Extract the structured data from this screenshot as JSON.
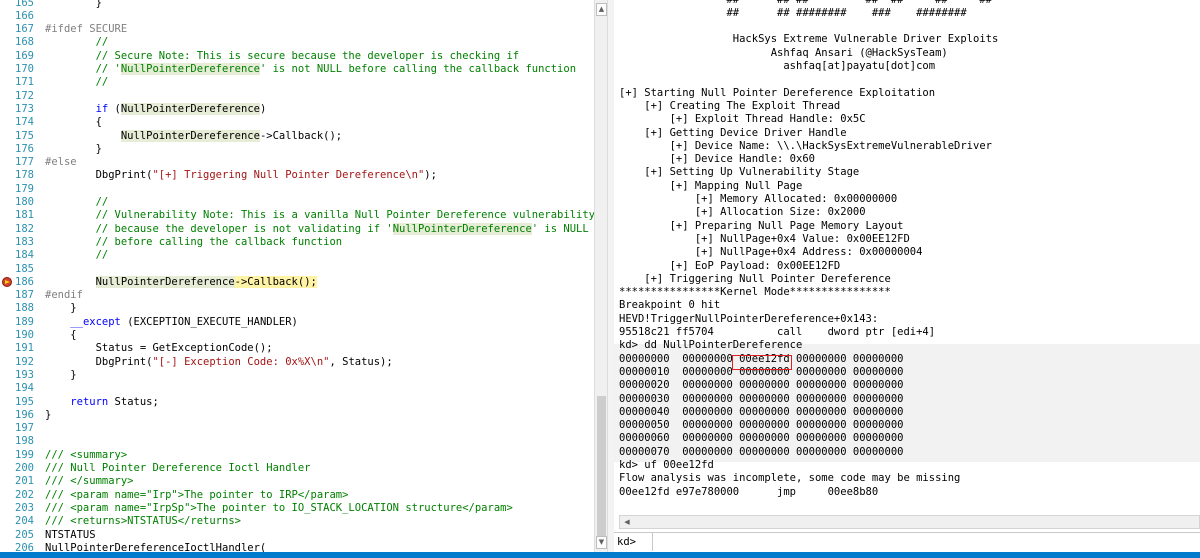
{
  "colors": {
    "keyword": "#0000ff",
    "comment": "#008000",
    "string": "#a31515",
    "line_number": "#2b91af",
    "symbol_highlight": "#e6ecd6",
    "current_line": "#fff3a6",
    "breakpoint": "#d04030",
    "status_bar": "#007acc",
    "annotation_box": "#e02020"
  },
  "editor": {
    "breakpoint_line": "186",
    "lines": [
      {
        "n": "165",
        "segs": [
          {
            "t": "        }"
          }
        ]
      },
      {
        "n": "166",
        "segs": []
      },
      {
        "n": "167",
        "segs": [
          {
            "t": "#ifdef SECURE",
            "c": "pp"
          }
        ]
      },
      {
        "n": "168",
        "segs": [
          {
            "t": "        //",
            "c": "cm"
          }
        ]
      },
      {
        "n": "169",
        "segs": [
          {
            "t": "        // Secure Note: This is secure because the developer is checking if",
            "c": "cm"
          }
        ]
      },
      {
        "n": "170",
        "segs": [
          {
            "t": "        // '",
            "c": "cm"
          },
          {
            "t": "NullPointerDereference",
            "c": "cm hl"
          },
          {
            "t": "' is not NULL before calling the callback function",
            "c": "cm"
          }
        ]
      },
      {
        "n": "171",
        "segs": [
          {
            "t": "        //",
            "c": "cm"
          }
        ]
      },
      {
        "n": "172",
        "segs": []
      },
      {
        "n": "173",
        "segs": [
          {
            "t": "        "
          },
          {
            "t": "if",
            "c": "kw"
          },
          {
            "t": " ("
          },
          {
            "t": "NullPointerDereference",
            "c": "hl"
          },
          {
            "t": ")"
          }
        ]
      },
      {
        "n": "174",
        "segs": [
          {
            "t": "        {"
          }
        ]
      },
      {
        "n": "175",
        "segs": [
          {
            "t": "            "
          },
          {
            "t": "NullPointerDereference",
            "c": "hl"
          },
          {
            "t": "->Callback();"
          }
        ]
      },
      {
        "n": "176",
        "segs": [
          {
            "t": "        }"
          }
        ]
      },
      {
        "n": "177",
        "segs": [
          {
            "t": "#else",
            "c": "pp"
          }
        ]
      },
      {
        "n": "178",
        "segs": [
          {
            "t": "        DbgPrint("
          },
          {
            "t": "\"[+] Triggering Null Pointer Dereference\\n\"",
            "c": "st"
          },
          {
            "t": ");"
          }
        ]
      },
      {
        "n": "179",
        "segs": []
      },
      {
        "n": "180",
        "segs": [
          {
            "t": "        //",
            "c": "cm"
          }
        ]
      },
      {
        "n": "181",
        "segs": [
          {
            "t": "        // Vulnerability Note: This is a vanilla Null Pointer Dereference vulnerability",
            "c": "cm"
          }
        ]
      },
      {
        "n": "182",
        "segs": [
          {
            "t": "        // because the developer is not validating if '",
            "c": "cm"
          },
          {
            "t": "NullPointerDereference",
            "c": "cm hl"
          },
          {
            "t": "' is NULL",
            "c": "cm"
          }
        ]
      },
      {
        "n": "183",
        "segs": [
          {
            "t": "        // before calling the callback function",
            "c": "cm"
          }
        ]
      },
      {
        "n": "184",
        "segs": [
          {
            "t": "        //",
            "c": "cm"
          }
        ]
      },
      {
        "n": "185",
        "segs": []
      },
      {
        "n": "186",
        "segs": [
          {
            "t": "        "
          },
          {
            "t": "NullPointerDereference",
            "c": "hl"
          },
          {
            "t": "->Callback();",
            "c": "exec"
          }
        ]
      },
      {
        "n": "187",
        "segs": [
          {
            "t": "#endif",
            "c": "pp"
          }
        ]
      },
      {
        "n": "188",
        "segs": [
          {
            "t": "    }"
          }
        ]
      },
      {
        "n": "189",
        "segs": [
          {
            "t": "    "
          },
          {
            "t": "__except",
            "c": "kw"
          },
          {
            "t": " (EXCEPTION_EXECUTE_HANDLER)"
          }
        ]
      },
      {
        "n": "190",
        "segs": [
          {
            "t": "    {"
          }
        ]
      },
      {
        "n": "191",
        "segs": [
          {
            "t": "        Status = GetExceptionCode();"
          }
        ]
      },
      {
        "n": "192",
        "segs": [
          {
            "t": "        DbgPrint("
          },
          {
            "t": "\"[-] Exception Code: 0x%X\\n\"",
            "c": "st"
          },
          {
            "t": ", Status);"
          }
        ]
      },
      {
        "n": "193",
        "segs": [
          {
            "t": "    }"
          }
        ]
      },
      {
        "n": "194",
        "segs": []
      },
      {
        "n": "195",
        "segs": [
          {
            "t": "    "
          },
          {
            "t": "return",
            "c": "kw"
          },
          {
            "t": " Status;"
          }
        ]
      },
      {
        "n": "196",
        "segs": [
          {
            "t": "}"
          }
        ]
      },
      {
        "n": "197",
        "segs": []
      },
      {
        "n": "198",
        "segs": []
      },
      {
        "n": "199",
        "segs": [
          {
            "t": "/// <summary>",
            "c": "cm"
          }
        ]
      },
      {
        "n": "200",
        "segs": [
          {
            "t": "/// Null Pointer Dereference Ioctl Handler",
            "c": "cm"
          }
        ]
      },
      {
        "n": "201",
        "segs": [
          {
            "t": "/// </summary>",
            "c": "cm"
          }
        ]
      },
      {
        "n": "202",
        "segs": [
          {
            "t": "/// <param name=\"Irp\">The pointer to IRP</param>",
            "c": "cm"
          }
        ]
      },
      {
        "n": "203",
        "segs": [
          {
            "t": "/// <param name=\"IrpSp\">The pointer to IO_STACK_LOCATION structure</param>",
            "c": "cm"
          }
        ]
      },
      {
        "n": "204",
        "segs": [
          {
            "t": "/// <returns>NTSTATUS</returns>",
            "c": "cm"
          }
        ]
      },
      {
        "n": "205",
        "segs": [
          {
            "t": "NTSTATUS"
          }
        ]
      },
      {
        "n": "206",
        "segs": [
          {
            "t": "NullPointerDereferenceIoctlHandler("
          }
        ]
      }
    ]
  },
  "scrollbar": {
    "up_icon": "triangle-up",
    "down_icon": "triangle-down"
  },
  "debugger": {
    "output": [
      "                 ##      ## ##         ##  ##     ##     ##",
      "                 ##      ## ########    ###    ########",
      "",
      "                  HackSys Extreme Vulnerable Driver Exploits",
      "                        Ashfaq Ansari (@HackSysTeam)",
      "                          ashfaq[at]payatu[dot]com",
      "",
      "[+] Starting Null Pointer Dereference Exploitation",
      "    [+] Creating The Exploit Thread",
      "        [+] Exploit Thread Handle: 0x5C",
      "    [+] Getting Device Driver Handle",
      "        [+] Device Name: \\\\.\\HackSysExtremeVulnerableDriver",
      "        [+] Device Handle: 0x60",
      "    [+] Setting Up Vulnerability Stage",
      "        [+] Mapping Null Page",
      "            [+] Memory Allocated: 0x00000000",
      "            [+] Allocation Size: 0x2000",
      "        [+] Preparing Null Page Memory Layout",
      "            [+] NullPage+0x4 Value: 0x00EE12FD",
      "            [+] NullPage+0x4 Address: 0x00000004",
      "        [+] EoP Payload: 0x00EE12FD",
      "    [+] Triggering Null Pointer Dereference",
      "****************Kernel Mode****************",
      "Breakpoint 0 hit",
      "HEVD!TriggerNullPointerDereference+0x143:",
      "95518c21 ff5704          call    dword ptr [edi+4]",
      "kd> dd NullPointerDereference",
      "00000000  00000000 00ee12fd 00000000 00000000",
      "00000010  00000000 00000000 00000000 00000000",
      "00000020  00000000 00000000 00000000 00000000",
      "00000030  00000000 00000000 00000000 00000000",
      "00000040  00000000 00000000 00000000 00000000",
      "00000050  00000000 00000000 00000000 00000000",
      "00000060  00000000 00000000 00000000 00000000",
      "00000070  00000000 00000000 00000000 00000000",
      "kd> uf 00ee12fd",
      "Flow analysis was incomplete, some code may be missing",
      "00ee12fd e97e780000      jmp     00ee8b80"
    ],
    "hscroll_left_icon": "triangle-left",
    "prompt": "kd>",
    "command_value": ""
  }
}
